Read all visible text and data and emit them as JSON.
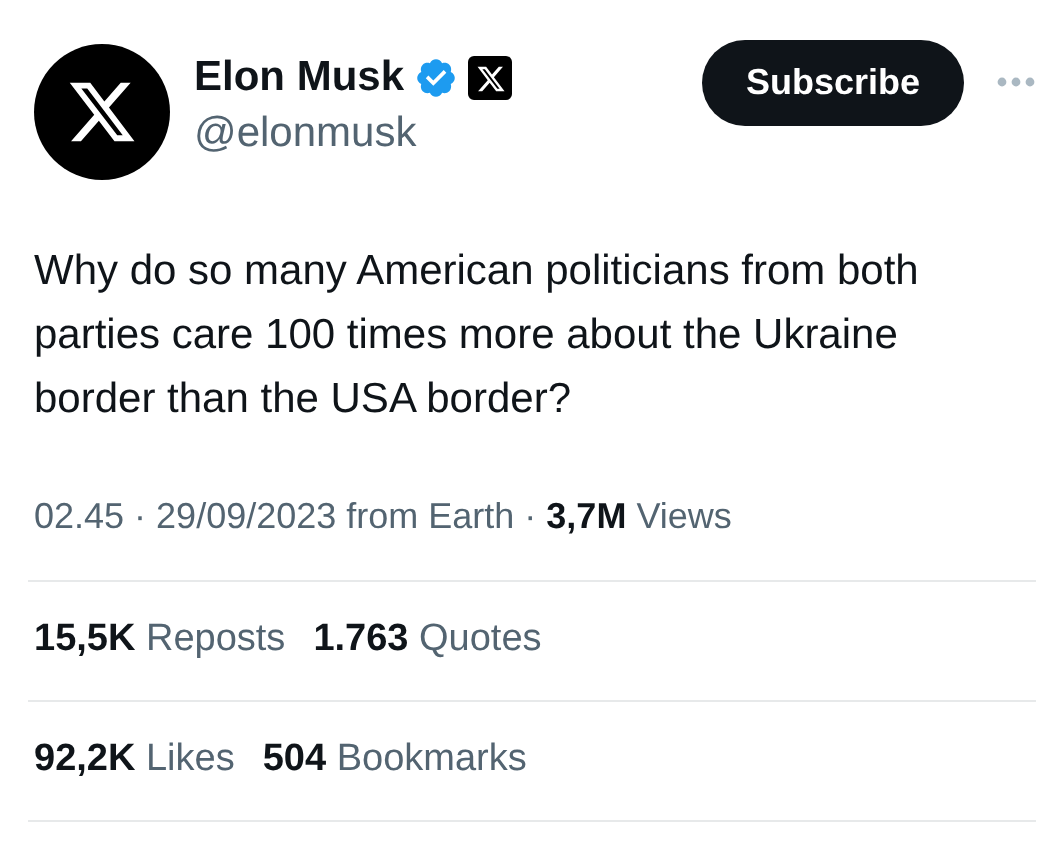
{
  "author": {
    "name": "Elon Musk",
    "handle": "@elonmusk",
    "verified": true,
    "affiliate_badge": true
  },
  "subscribe_button": "Subscribe",
  "post": {
    "text": "Why do so many American politicians from both parties care 100 times more about the Ukraine border than the USA border?"
  },
  "meta": {
    "time": "02.45",
    "separator": "·",
    "date": "29/09/2023 from Earth",
    "views_count": "3,7M",
    "views_label": "Views"
  },
  "stat_rows": [
    [
      {
        "count": "15,5K",
        "label": "Reposts"
      },
      {
        "count": "1.763",
        "label": "Quotes"
      }
    ],
    [
      {
        "count": "92,2K",
        "label": "Likes"
      },
      {
        "count": "504",
        "label": "Bookmarks"
      }
    ]
  ]
}
